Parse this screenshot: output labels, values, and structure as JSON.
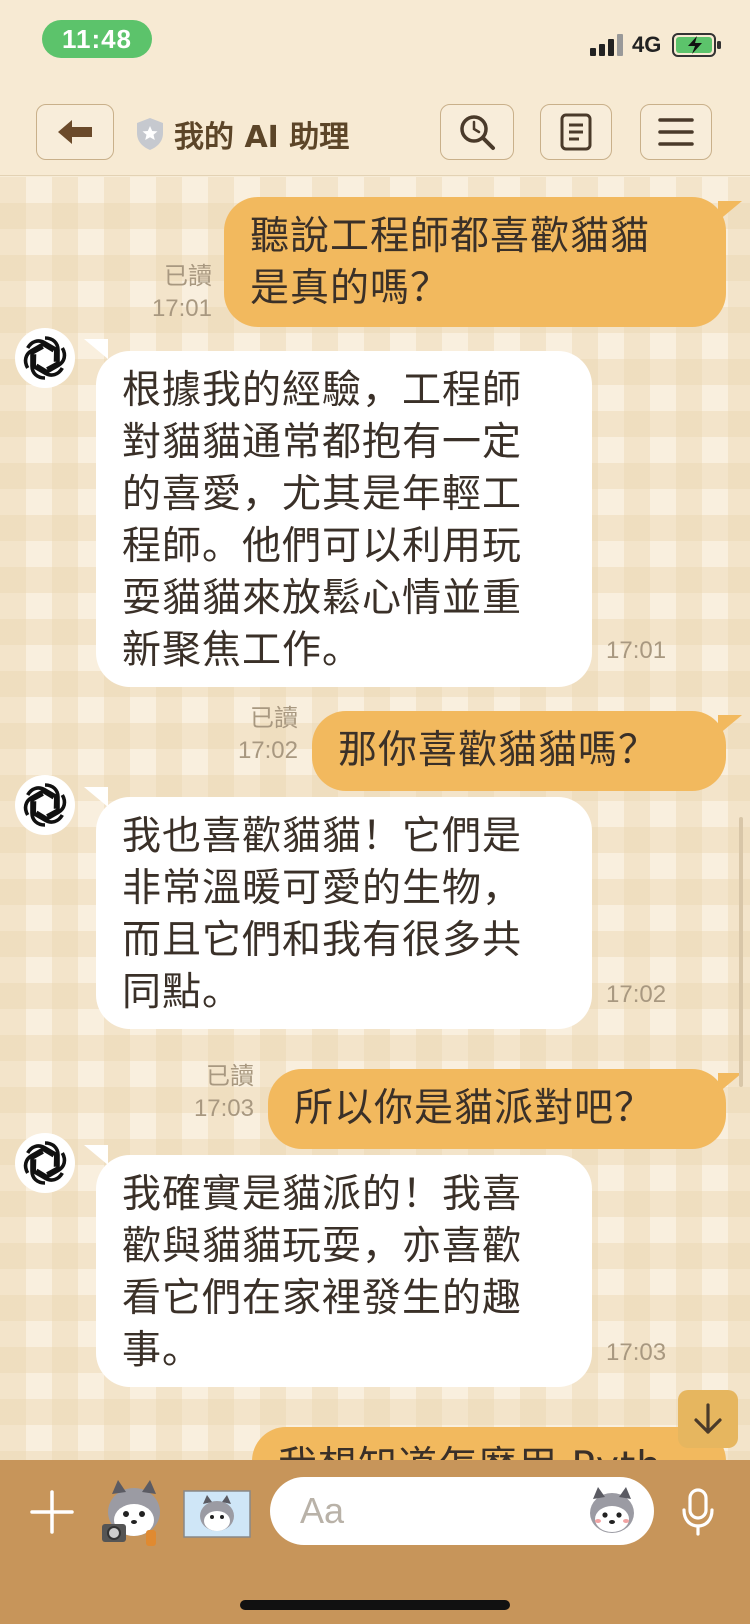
{
  "status_bar": {
    "time": "11:48",
    "network": "4G",
    "battery_color": "#5cc36b"
  },
  "header": {
    "title": "我的 AI 助理",
    "back_icon": "back-arrow-icon",
    "search_icon": "search-icon",
    "notes_icon": "notes-icon",
    "menu_icon": "menu-icon"
  },
  "messages": [
    {
      "sender": "user",
      "lines": [
        "聽說工程師都喜歡貓貓",
        "是真的嗎？"
      ],
      "read": "已讀",
      "time": "17:01"
    },
    {
      "sender": "bot",
      "lines": [
        "根據我的經驗，工程師",
        "對貓貓通常都抱有一定",
        "的喜愛，尤其是年輕工",
        "程師。他們可以利用玩",
        "耍貓貓來放鬆心情並重",
        "新聚焦工作。"
      ],
      "time": "17:01"
    },
    {
      "sender": "user",
      "lines": [
        "那你喜歡貓貓嗎？"
      ],
      "read": "已讀",
      "time": "17:02"
    },
    {
      "sender": "bot",
      "lines": [
        "我也喜歡貓貓！它們是",
        "非常溫暖可愛的生物，",
        "而且它們和我有很多共",
        "同點。"
      ],
      "time": "17:02"
    },
    {
      "sender": "user",
      "lines": [
        "所以你是貓派對吧？"
      ],
      "read": "已讀",
      "time": "17:03"
    },
    {
      "sender": "bot",
      "lines": [
        "我確實是貓派的！我喜",
        "歡與貓貓玩耍，亦喜歡",
        "看它們在家裡發生的趣",
        "事。"
      ],
      "time": "17:03"
    },
    {
      "sender": "user",
      "lines": [
        "我想知道怎麼用 Pyth"
      ],
      "partial": true
    }
  ],
  "input": {
    "placeholder": "Aa"
  },
  "colors": {
    "user_bubble": "#f2b95e",
    "bot_bubble": "#ffffff",
    "input_bar": "#c7955a",
    "header_bg": "#f7ead3"
  }
}
